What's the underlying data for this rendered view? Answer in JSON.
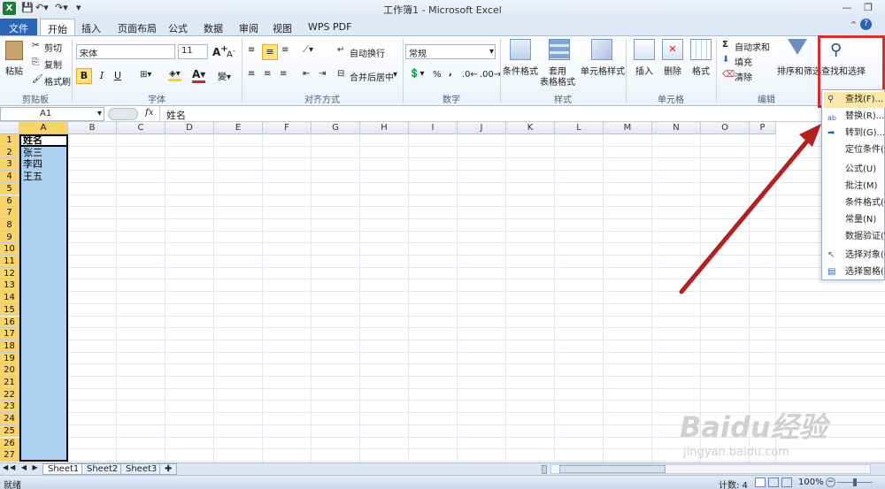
{
  "window": {
    "title": "工作簿1 - Microsoft Excel"
  },
  "tabs": [
    {
      "label": "文件"
    },
    {
      "label": "开始"
    },
    {
      "label": "插入"
    },
    {
      "label": "页面布局"
    },
    {
      "label": "公式"
    },
    {
      "label": "数据"
    },
    {
      "label": "审阅"
    },
    {
      "label": "视图"
    },
    {
      "label": "WPS PDF"
    }
  ],
  "ribbon": {
    "clipboard": {
      "paste": "粘贴",
      "cut": "剪切",
      "copy": "复制",
      "format_painter": "格式刷",
      "group": "剪贴板"
    },
    "font": {
      "name": "宋体",
      "size": "11",
      "bold": "B",
      "italic": "I",
      "underline": "U",
      "group": "字体"
    },
    "alignment": {
      "wrap": "自动换行",
      "merge": "合并后居中",
      "group": "对齐方式"
    },
    "number": {
      "format": "常规",
      "percent": "%",
      "comma": ",",
      "group": "数字"
    },
    "styles": {
      "conditional": "条件格式",
      "table_line1": "套用",
      "table_line2": "表格格式",
      "cell_styles": "单元格样式",
      "group": "样式"
    },
    "cells": {
      "insert": "插入",
      "delete": "删除",
      "format": "格式",
      "group": "单元格"
    },
    "editing": {
      "autosum": "自动求和",
      "fill": "填充",
      "clear": "清除",
      "sort": "排序和筛选",
      "find": "查找和选择",
      "group": "编辑"
    }
  },
  "formula_bar": {
    "name_box": "A1",
    "fx": "fx",
    "content": "姓名"
  },
  "columns": [
    "A",
    "B",
    "C",
    "D",
    "E",
    "F",
    "G",
    "H",
    "I",
    "J",
    "K",
    "L",
    "M",
    "N",
    "O",
    "P"
  ],
  "rows": [
    "1",
    "2",
    "3",
    "4",
    "5",
    "6",
    "7",
    "8",
    "9",
    "10",
    "11",
    "12",
    "13",
    "14",
    "15",
    "16",
    "17",
    "18",
    "19",
    "20",
    "21",
    "22",
    "23",
    "24",
    "25",
    "26",
    "27"
  ],
  "cells": {
    "A1": "姓名",
    "A2": "张三",
    "A3": "李四",
    "A4": "王五"
  },
  "find_menu": [
    {
      "label": "查找(F)...",
      "icon": "binoculars-icon"
    },
    {
      "label": "替换(R)...",
      "icon": "replace-icon"
    },
    {
      "label": "转到(G)...",
      "icon": "arrow-right-icon"
    },
    {
      "label": "定位条件(S)"
    },
    {
      "label": "公式(U)"
    },
    {
      "label": "批注(M)"
    },
    {
      "label": "条件格式(C)"
    },
    {
      "label": "常量(N)"
    },
    {
      "label": "数据验证(V)"
    },
    {
      "label": "选择对象(O)",
      "icon": "cursor-icon"
    },
    {
      "label": "选择窗格(P)...",
      "icon": "selection-pane-icon"
    }
  ],
  "sheets": [
    "Sheet1",
    "Sheet2",
    "Sheet3"
  ],
  "status": {
    "ready": "就绪",
    "count": "计数: 4",
    "zoom": "100%"
  },
  "watermark": "Baidu经验",
  "watermark_url": "jingyan.baidu.com",
  "colors": {
    "accent": "#2a64b7",
    "highlight_red": "#d32f2f",
    "selection": "#aed0f0",
    "header_highlight": "#f8d46c"
  }
}
